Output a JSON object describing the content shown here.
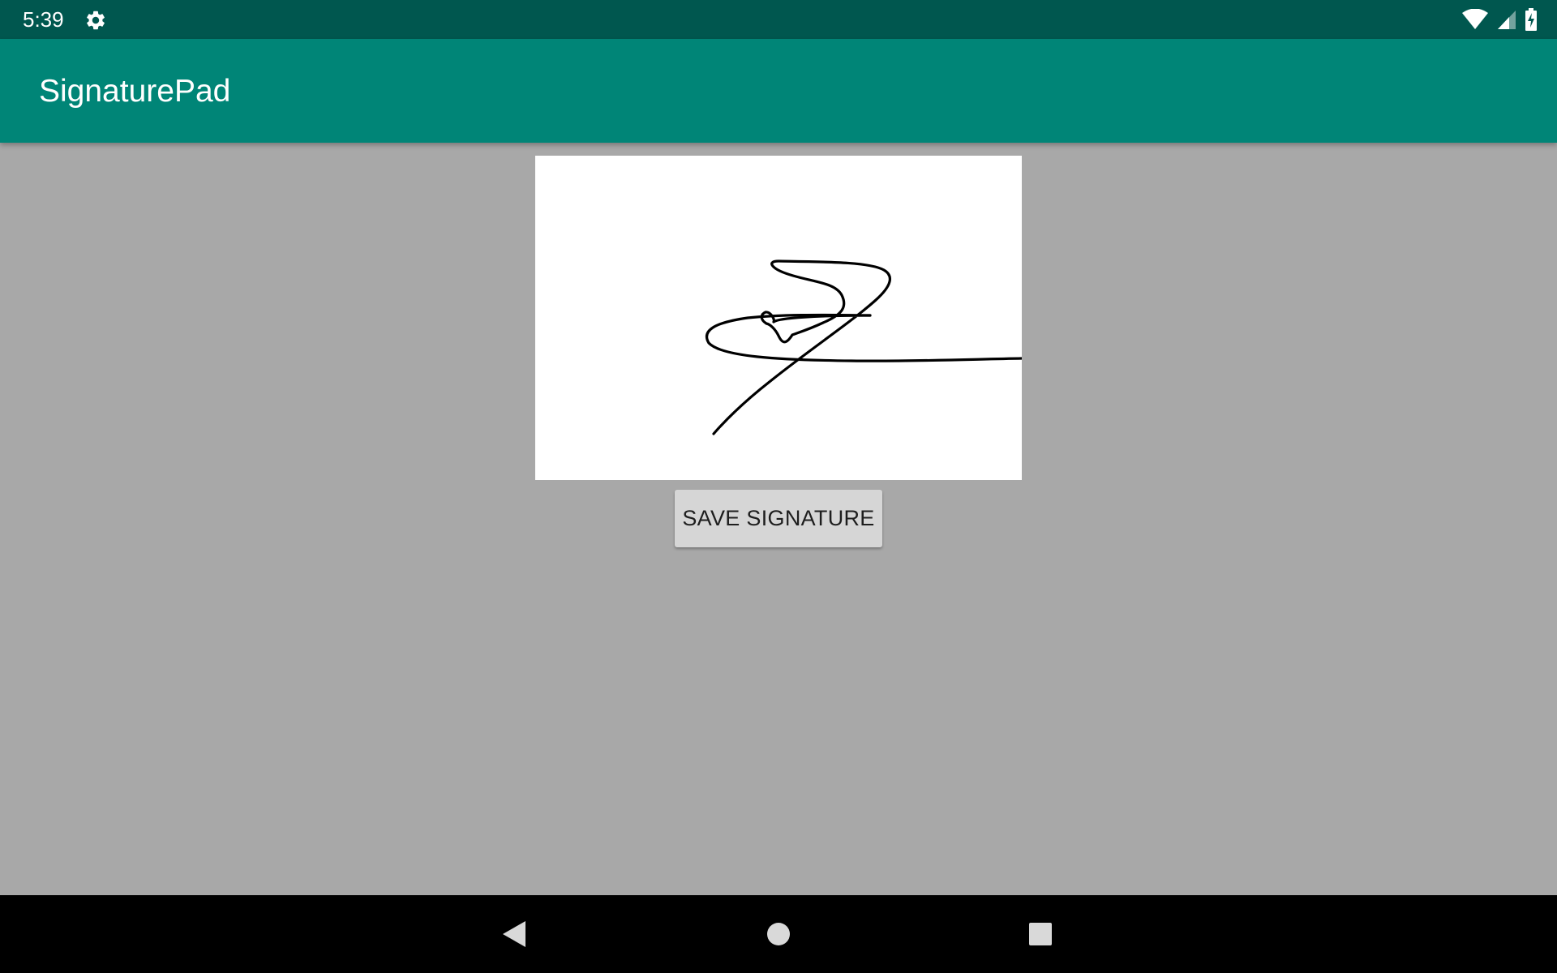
{
  "status_bar": {
    "time": "5:39",
    "icons": [
      "gear-icon",
      "wifi-icon",
      "cell-signal-icon",
      "battery-charging-icon"
    ]
  },
  "app_bar": {
    "title": "SignaturePad"
  },
  "signature_pad": {
    "background": "#ffffff",
    "stroke_color": "#000000"
  },
  "save_button": {
    "label": "SAVE SIGNATURE"
  },
  "nav_bar": {
    "buttons": [
      "back-icon",
      "home-icon",
      "recents-icon"
    ]
  },
  "colors": {
    "status_bar": "#00574f",
    "app_bar": "#008577",
    "content_background": "#a8a8a8",
    "button": "#d6d6d6",
    "nav_bar": "#000000"
  }
}
